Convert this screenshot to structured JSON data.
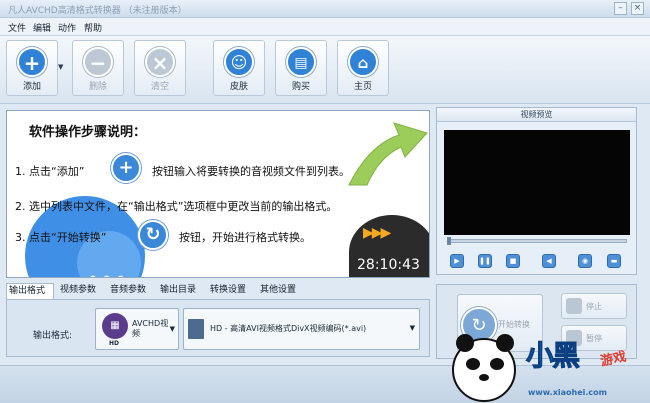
{
  "window": {
    "title": "凡人AVCHD高清格式转换器 （未注册版本）",
    "minimize": "–",
    "close": "×"
  },
  "menu": [
    "文件",
    "编辑",
    "动作",
    "帮助"
  ],
  "toolbar": {
    "add": {
      "label": "添加",
      "icon": "plus-icon"
    },
    "delete": {
      "label": "删除",
      "icon": "minus-icon"
    },
    "clear": {
      "label": "清空",
      "icon": "x-icon"
    },
    "skin": {
      "label": "皮肤",
      "icon": "smiley-icon"
    },
    "buy": {
      "label": "购买",
      "icon": "cart-icon"
    },
    "home": {
      "label": "主页",
      "icon": "home-icon"
    }
  },
  "guide": {
    "heading": "软件操作步骤说明：",
    "step1_a": "1. 点击“添加”",
    "step1_b": "按钮输入将要转换的音视频文件到列表。",
    "step2": "2. 选中列表中文件，在“输出格式”选项框中更改当前的输出格式。",
    "step3_a": "3. 点击“开始转换”",
    "step3_b": "按钮，开始进行格式转换。",
    "timer": "28:10:43"
  },
  "preview": {
    "title": "视频预览"
  },
  "tabs": [
    "输出格式",
    "视频参数",
    "音频参数",
    "输出目录",
    "转换设置",
    "其他设置"
  ],
  "format": {
    "label": "输出格式:",
    "category": "AVCHD视频",
    "category_badge": "HD",
    "selected": "HD - 高清AVI视频格式DivX视频编码(*.avi)"
  },
  "actions": {
    "start": "开始转换",
    "stop": "停止",
    "pause": "暂停"
  },
  "watermark": {
    "big": "小黑",
    "small": "游戏",
    "url": "www.xiaohei.com"
  },
  "colors": {
    "accent": "#3b87d8",
    "screen": "#050505",
    "timer_accent": "#f6a821"
  }
}
